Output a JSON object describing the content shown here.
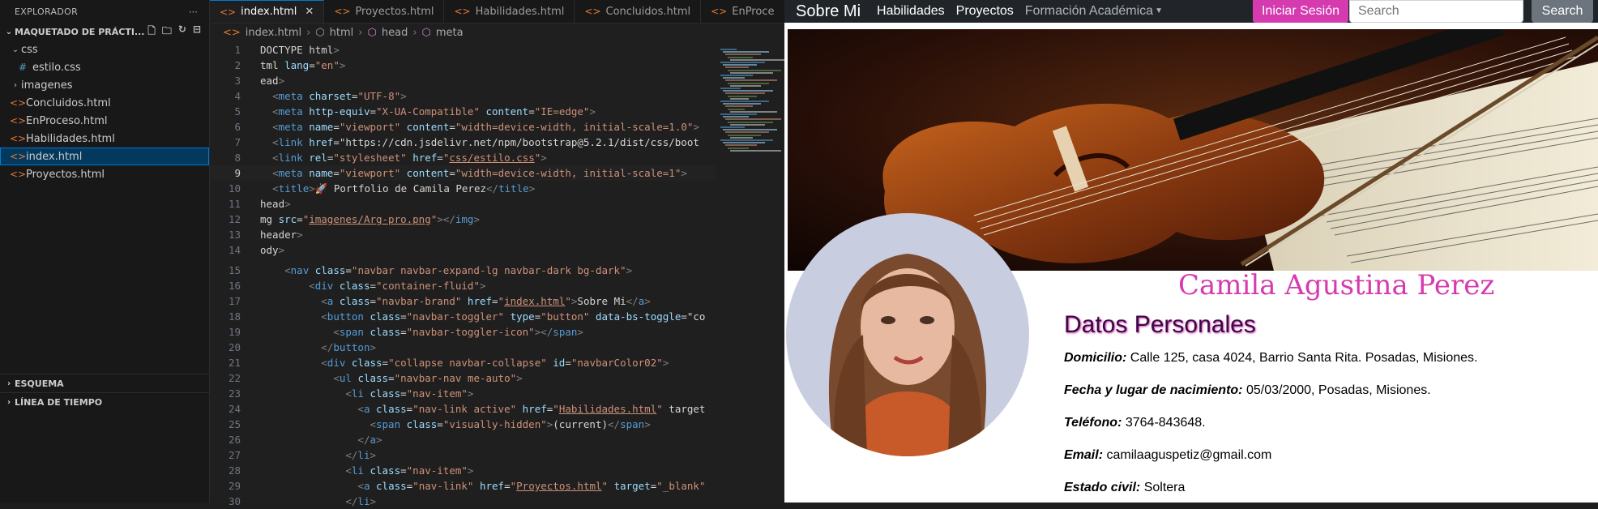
{
  "explorer": {
    "title": "EXPLORADOR",
    "workspace": "MAQUETADO DE PRÁCTI...",
    "tree": [
      {
        "label": "css",
        "kind": "folder-open"
      },
      {
        "label": "estilo.css",
        "kind": "css"
      },
      {
        "label": "imagenes",
        "kind": "folder-closed"
      },
      {
        "label": "Concluidos.html",
        "kind": "html"
      },
      {
        "label": "EnProceso.html",
        "kind": "html"
      },
      {
        "label": "Habilidades.html",
        "kind": "html"
      },
      {
        "label": "index.html",
        "kind": "html",
        "selected": true
      },
      {
        "label": "Proyectos.html",
        "kind": "html"
      }
    ],
    "outline": "ESQUEMA",
    "timeline": "LÍNEA DE TIEMPO"
  },
  "editor": {
    "tabs": [
      {
        "label": "index.html",
        "active": true
      },
      {
        "label": "Proyectos.html",
        "active": false
      },
      {
        "label": "Habilidades.html",
        "active": false
      },
      {
        "label": "Concluidos.html",
        "active": false
      },
      {
        "label": "EnProce",
        "active": false
      }
    ],
    "breadcrumb": [
      "index.html",
      "html",
      "head",
      "meta"
    ],
    "current_line": 9,
    "lines": [
      {
        "n": "1",
        "text": "DOCTYPE html>"
      },
      {
        "n": "2",
        "text": "tml lang=\"en\">"
      },
      {
        "n": "3",
        "text": "ead>"
      },
      {
        "n": "4",
        "text": "  <meta charset=\"UTF-8\">"
      },
      {
        "n": "5",
        "text": "  <meta http-equiv=\"X-UA-Compatible\" content=\"IE=edge\">"
      },
      {
        "n": "6",
        "text": "  <meta name=\"viewport\" content=\"width=device-width, initial-scale=1.0\">"
      },
      {
        "n": "7",
        "text": "  <link href=\"https://cdn.jsdelivr.net/npm/bootstrap@5.2.1/dist/css/boot"
      },
      {
        "n": "8",
        "text": "  <link rel=\"stylesheet\" href=\"css/estilo.css\">"
      },
      {
        "n": "9",
        "text": "  <meta name=\"viewport\" content=\"width=device-width, initial-scale=1\">"
      },
      {
        "n": "10",
        "text": "  <title>🚀 Portfolio de Camila Perez</title>"
      },
      {
        "n": "11",
        "text": "head>"
      },
      {
        "n": "12",
        "text": "mg src=\"imagenes/Arg-pro.png\"></img>"
      },
      {
        "n": "13",
        "text": "header>"
      },
      {
        "n": "14",
        "text": "ody>"
      },
      {
        "n": "15",
        "text": "    <nav class=\"navbar navbar-expand-lg navbar-dark bg-dark\">"
      },
      {
        "n": "16",
        "text": "        <div class=\"container-fluid\">"
      },
      {
        "n": "17",
        "text": "          <a class=\"navbar-brand\" href=\"index.html\">Sobre Mi</a>"
      },
      {
        "n": "18",
        "text": "          <button class=\"navbar-toggler\" type=\"button\" data-bs-toggle=\"co"
      },
      {
        "n": "19",
        "text": "            <span class=\"navbar-toggler-icon\"></span>"
      },
      {
        "n": "20",
        "text": "          </button>"
      },
      {
        "n": "21",
        "text": "          <div class=\"collapse navbar-collapse\" id=\"navbarColor02\">"
      },
      {
        "n": "22",
        "text": "            <ul class=\"navbar-nav me-auto\">"
      },
      {
        "n": "23",
        "text": "              <li class=\"nav-item\">"
      },
      {
        "n": "24",
        "text": "                <a class=\"nav-link active\" href=\"Habilidades.html\" target"
      },
      {
        "n": "25",
        "text": "                  <span class=\"visually-hidden\">(current)</span>"
      },
      {
        "n": "26",
        "text": "                </a>"
      },
      {
        "n": "27",
        "text": "              </li>"
      },
      {
        "n": "28",
        "text": "              <li class=\"nav-item\">"
      },
      {
        "n": "29",
        "text": "                <a class=\"nav-link\" href=\"Proyectos.html\" target=\"_blank\""
      },
      {
        "n": "30",
        "text": "              </li>"
      }
    ]
  },
  "site": {
    "brand": "Sobre Mi",
    "nav": [
      "Habilidades",
      "Proyectos",
      "Formación Académica"
    ],
    "login_label": "Iniciar Sesión",
    "search_placeholder": "Search",
    "search_button": "Search",
    "name": "Camila Agustina Perez",
    "section_title": "Datos Personales",
    "info": [
      {
        "label": "Domicilio:",
        "value": "Calle 125, casa 4024, Barrio Santa Rita. Posadas, Misiones."
      },
      {
        "label": "Fecha y lugar de nacimiento:",
        "value": "05/03/2000, Posadas, Misiones."
      },
      {
        "label": "Teléfono:",
        "value": "3764-843648."
      },
      {
        "label": "Email:",
        "value": "camilaaguspetiz@gmail.com"
      },
      {
        "label": "Estado civil:",
        "value": "Soltera"
      }
    ]
  },
  "colors": {
    "accent": "#d63aaf",
    "navbar": "#212529",
    "editor_bg": "#1f1f1f",
    "selection": "#04395e"
  },
  "icons": [
    "new-file-icon",
    "new-folder-icon",
    "refresh-icon",
    "collapse-all-icon",
    "split-editor-icon",
    "more-icon",
    "violin-banner",
    "profile-photo"
  ]
}
